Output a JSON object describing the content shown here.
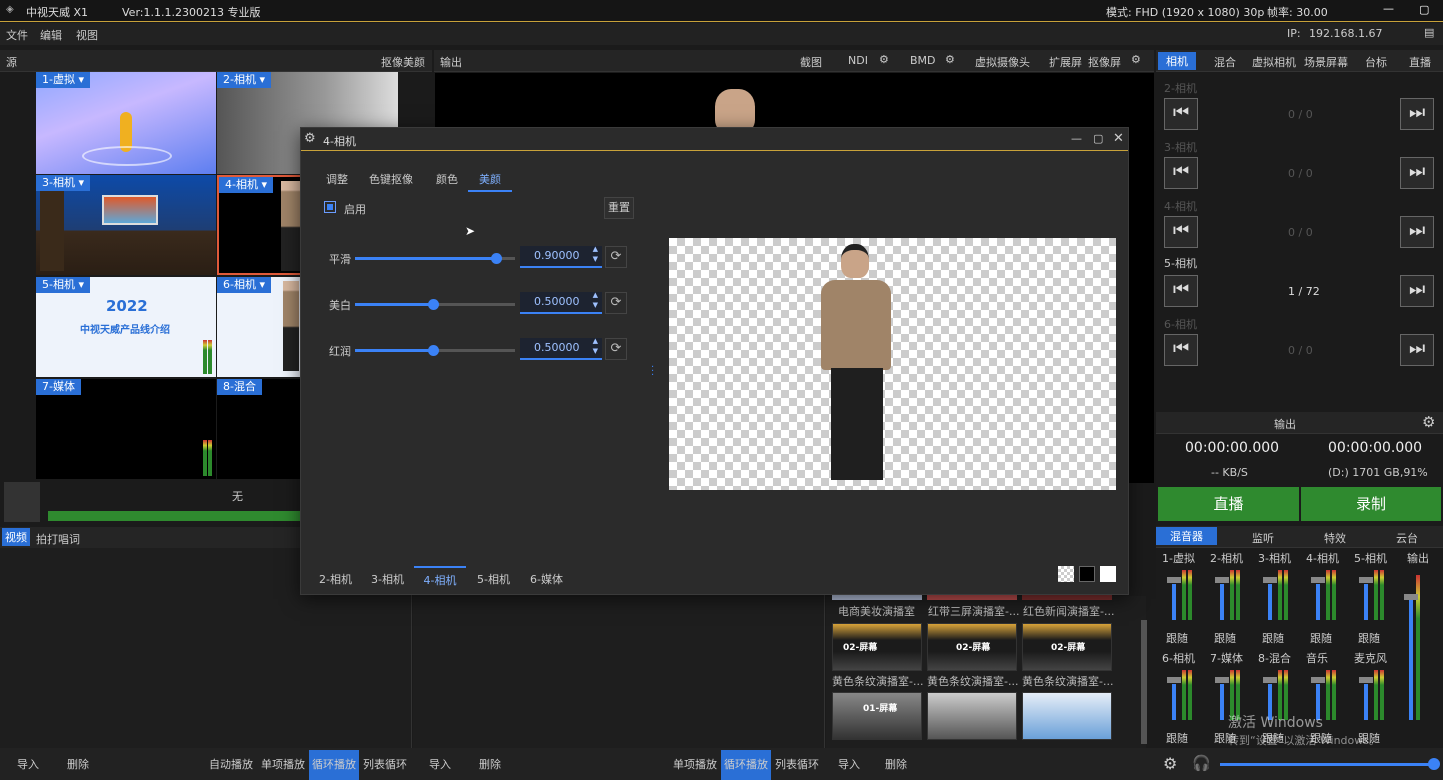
{
  "app": {
    "icon": "app-logo-icon",
    "name": "中视天威 X1",
    "version": "Ver:1.1.1.2300213 专业版",
    "mode": "模式: FHD (1920 x 1080)  30p",
    "framerate": "帧率: 30.00",
    "ip_label": "IP:",
    "ip": "192.168.1.67"
  },
  "menu": [
    "文件",
    "编辑",
    "视图"
  ],
  "source": {
    "title": "源",
    "camera_beauty": "抠像美颜",
    "output_label": "输出",
    "none_label": "无",
    "tiles": [
      {
        "label": "1-虚拟 ▾"
      },
      {
        "label": "2-相机 ▾"
      },
      {
        "label": "3-相机 ▾"
      },
      {
        "label": "4-相机 ▾"
      },
      {
        "label": "5-相机 ▾"
      },
      {
        "label": "6-相机 ▾"
      },
      {
        "label": "7-媒体"
      },
      {
        "label": "8-混合"
      }
    ],
    "slide_year": "2022",
    "slide_title": "中视天威产品线介绍"
  },
  "toolbar": {
    "screenshot": "截图",
    "ndi": "NDI",
    "bmd": "BMD",
    "virtual_cam": "虚拟摄像头",
    "extend": "扩展屏",
    "keyscreen": "抠像屏"
  },
  "right_tabs": [
    "相机",
    "混合",
    "虚拟相机",
    "场景屏幕",
    "台标",
    "直播"
  ],
  "cameras": [
    {
      "name": "2-相机",
      "count": "0 / 0"
    },
    {
      "name": "3-相机",
      "count": "0 / 0"
    },
    {
      "name": "4-相机",
      "count": "0 / 0"
    },
    {
      "name": "5-相机",
      "count": "1 / 72"
    },
    {
      "name": "6-相机",
      "count": "0 / 0"
    }
  ],
  "output": {
    "title": "输出",
    "time_live": "00:00:00.000",
    "time_rec": "00:00:00.000",
    "rate": "-- KB/S",
    "disk": "(D:) 1701 GB,91%",
    "live_btn": "直播",
    "rec_btn": "录制"
  },
  "mixer": {
    "tabs": [
      "混音器",
      "监听",
      "特效",
      "云台"
    ],
    "channels": [
      {
        "name": "1-虚拟",
        "mode": "跟随"
      },
      {
        "name": "2-相机",
        "mode": "跟随"
      },
      {
        "name": "3-相机",
        "mode": "跟随"
      },
      {
        "name": "4-相机",
        "mode": "跟随"
      },
      {
        "name": "5-相机",
        "mode": "跟随"
      },
      {
        "name": "6-相机",
        "mode": "跟随"
      },
      {
        "name": "7-媒体",
        "mode": "跟随"
      },
      {
        "name": "8-混合",
        "mode": "跟随"
      },
      {
        "name": "音乐",
        "mode": "跟随"
      },
      {
        "name": "麦克风",
        "mode": "跟随"
      }
    ],
    "output_label": "输出"
  },
  "dialog": {
    "title": "4-相机",
    "tabs": [
      "调整",
      "色键抠像",
      "颜色",
      "美颜"
    ],
    "enable_label": "启用",
    "reset_label": "重置",
    "sliders": [
      {
        "label": "平滑",
        "value": "0.90000",
        "fraction": 0.9
      },
      {
        "label": "美白",
        "value": "0.50000",
        "fraction": 0.5
      },
      {
        "label": "红润",
        "value": "0.50000",
        "fraction": 0.5
      }
    ],
    "bottom_tabs": [
      "2-相机",
      "3-相机",
      "4-相机",
      "5-相机",
      "6-媒体"
    ]
  },
  "lower": {
    "video_tab": "视频",
    "beat_tab": "拍打唱词"
  },
  "scenes": [
    {
      "name": "电商美妆演播室"
    },
    {
      "name": "红带三屏演播室-..."
    },
    {
      "name": "红色新闻演播室-..."
    },
    {
      "name": "黄色条纹演播室-..."
    },
    {
      "name": "黄色条纹演播室-..."
    },
    {
      "name": "黄色条纹演播室-..."
    }
  ],
  "thumb_texts": {
    "t1": "02-屏幕",
    "t2": "02-屏幕",
    "t3": "02-屏幕",
    "t4": "01-屏幕"
  },
  "bottom_left": [
    "导入",
    "删除",
    "自动播放",
    "单项播放",
    "循环播放",
    "列表循环"
  ],
  "bottom_mid": [
    "导入",
    "删除",
    "单项播放",
    "循环播放",
    "列表循环"
  ],
  "bottom_right": [
    "导入",
    "删除"
  ],
  "watermark": {
    "line1": "激活 Windows",
    "line2": "转到“设置”以激活 Windows。"
  },
  "colors": {
    "accent": "#2a6fd6",
    "live": "#2f8a2f",
    "gold": "#c8a23a"
  }
}
